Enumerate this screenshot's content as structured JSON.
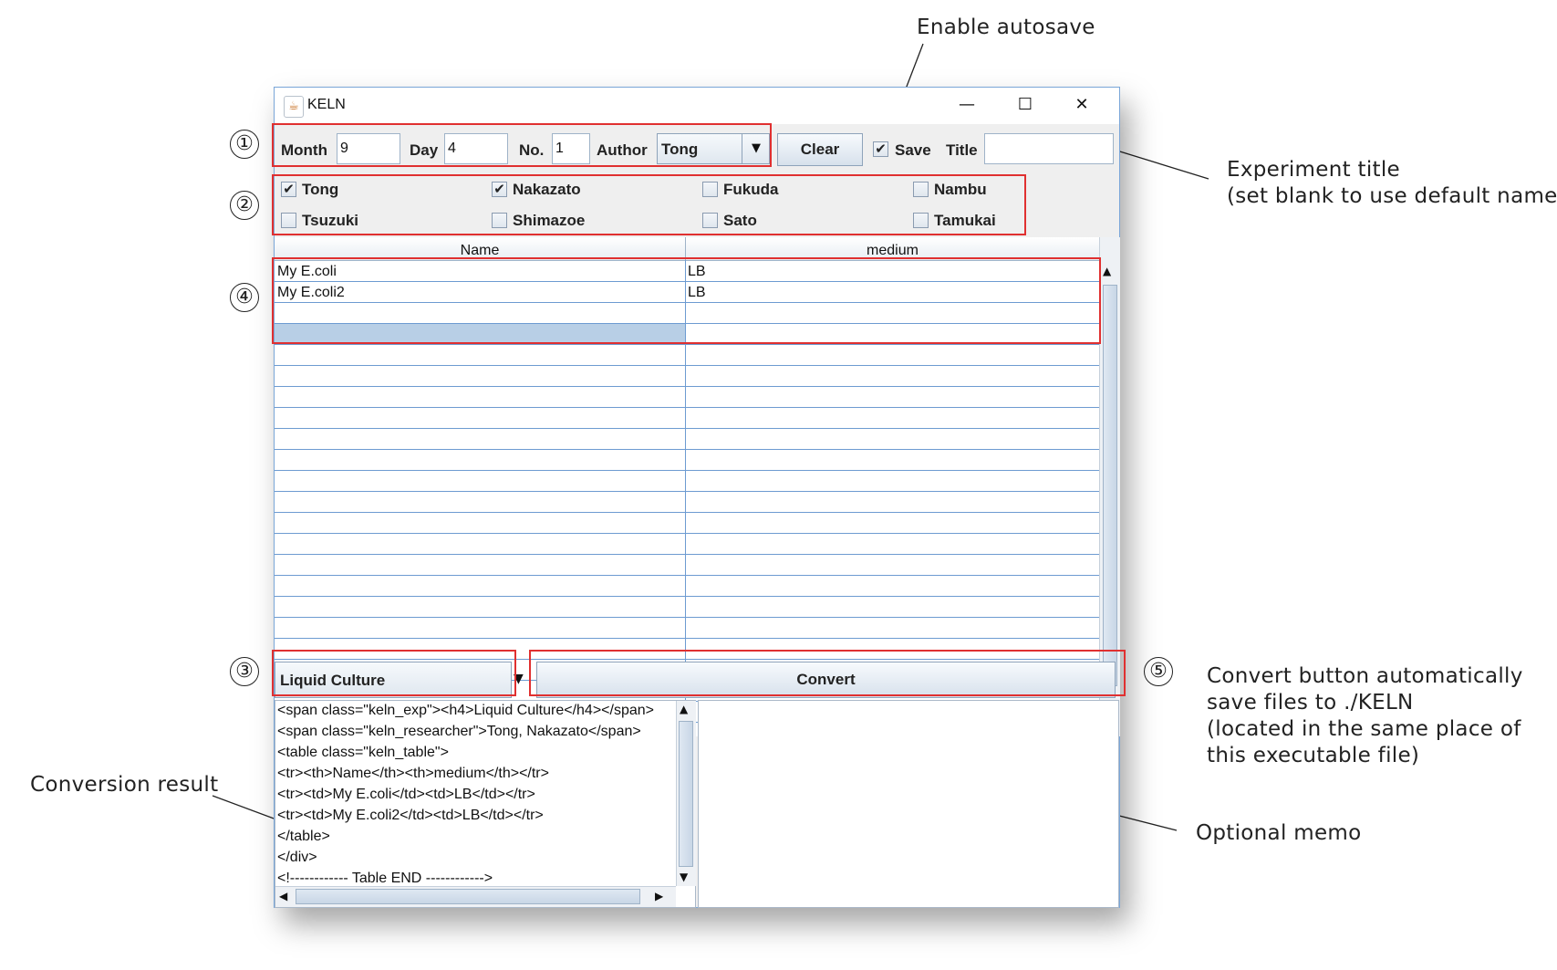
{
  "window": {
    "title": "KELN",
    "controls": {
      "minimize": "—",
      "maximize": "☐",
      "close": "✕"
    }
  },
  "toolbar": {
    "month_label": "Month",
    "month_value": "9",
    "day_label": "Day",
    "day_value": "4",
    "no_label": "No.",
    "no_value": "1",
    "author_label": "Author",
    "author_value": "Tong",
    "clear_label": "Clear",
    "save_label": "Save",
    "save_checked": true,
    "title_label": "Title",
    "title_value": ""
  },
  "researchers": [
    {
      "name": "Tong",
      "checked": true
    },
    {
      "name": "Nakazato",
      "checked": true
    },
    {
      "name": "Fukuda",
      "checked": false
    },
    {
      "name": "Nambu",
      "checked": false
    },
    {
      "name": "Tsuzuki",
      "checked": false
    },
    {
      "name": "Shimazoe",
      "checked": false
    },
    {
      "name": "Sato",
      "checked": false
    },
    {
      "name": "Tamukai",
      "checked": false
    }
  ],
  "table": {
    "headers": [
      "Name",
      "medium"
    ],
    "rows": [
      [
        "My E.coli",
        "LB"
      ],
      [
        "My E.coli2",
        "LB"
      ]
    ]
  },
  "experiment_type": "Liquid Culture",
  "convert_label": "Convert",
  "output_lines": [
    "<span class=\"keln_exp\"><h4>Liquid Culture</h4></span>",
    "<span class=\"keln_researcher\">Tong, Nakazato</span>",
    "<table class=\"keln_table\">",
    "<tr><th>Name</th><th>medium</th></tr>",
    "<tr><td>My E.coli</td><td>LB</td></tr>",
    "<tr><td>My E.coli2</td><td>LB</td></tr>",
    "</table>",
    "</div>",
    "<!------------ Table END ------------>"
  ],
  "memo": "",
  "annotations": {
    "autosave": "Enable autosave",
    "exp_title_1": "Experiment title",
    "exp_title_2": "(set blank to use default name)",
    "convert_1": "Convert button automatically",
    "convert_2": "save files to ./KELN",
    "convert_3": "(located in the same place of",
    "convert_4": "this executable file)",
    "conversion_result": "Conversion result",
    "optional_memo": "Optional memo",
    "markers": [
      "①",
      "②",
      "③",
      "④",
      "⑤"
    ]
  }
}
